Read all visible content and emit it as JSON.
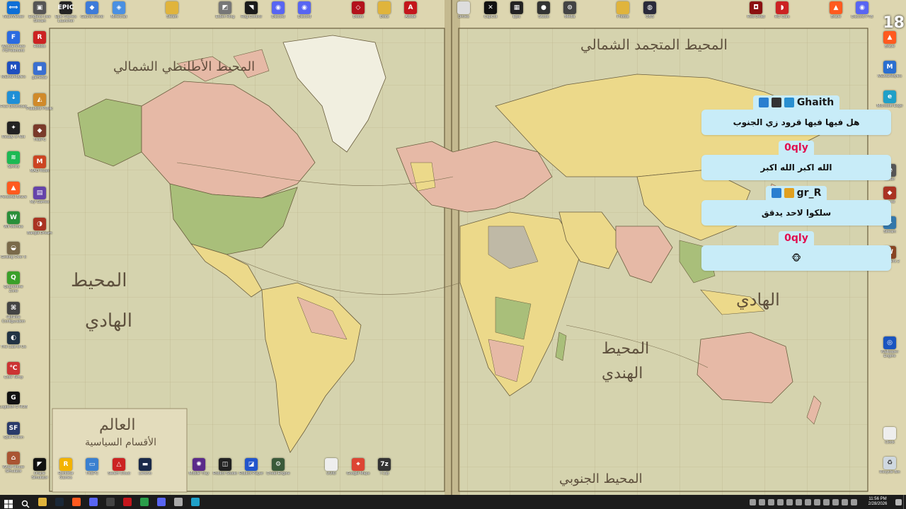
{
  "desktop": {
    "corner_number": "18",
    "top_row": [
      {
        "label": "TeamViewer",
        "icon": "teamviewer-icon",
        "color": "#0e6fd6",
        "glyph": "⟺"
      },
      {
        "label": "Endless Live Stream",
        "icon": "app-icon",
        "color": "#555555",
        "glyph": "▣"
      },
      {
        "label": "Epic Games Launcher",
        "icon": "epic-icon",
        "color": "#222222",
        "glyph": "EPIC"
      },
      {
        "label": "Gacha World",
        "icon": "game-icon",
        "color": "#3d7bd9",
        "glyph": "◆"
      },
      {
        "label": "Minecraft",
        "icon": "minecraft-icon",
        "color": "#4a90e2",
        "glyph": "◈"
      },
      {
        "label": "Steam",
        "icon": "folder-icon",
        "color": "#e0b43c",
        "glyph": ""
      },
      {
        "label": "Elden Ring",
        "icon": "game-icon",
        "color": "#777777",
        "glyph": "◩"
      },
      {
        "label": "Rog Control",
        "icon": "rog-icon",
        "color": "#1a1a1a",
        "glyph": "◥"
      },
      {
        "label": "Discord",
        "icon": "discord-icon",
        "color": "#5865f2",
        "glyph": "◉"
      },
      {
        "label": "Discord",
        "icon": "discord-icon",
        "color": "#5865f2",
        "glyph": "◉"
      },
      {
        "label": "Doom",
        "icon": "game-icon",
        "color": "#b3121b",
        "glyph": "◇"
      },
      {
        "label": "Docs",
        "icon": "folder-icon",
        "color": "#e0b43c",
        "glyph": ""
      },
      {
        "label": "Adobe",
        "icon": "acrobat-icon",
        "color": "#c4161c",
        "glyph": "A"
      },
      {
        "label": "Drives",
        "icon": "drive-icon",
        "color": "#dddddd",
        "glyph": ""
      },
      {
        "label": "CapCut",
        "icon": "capcut-icon",
        "color": "#111111",
        "glyph": "✕"
      },
      {
        "label": "Epic",
        "icon": "app-icon",
        "color": "#222222",
        "glyph": "▦"
      },
      {
        "label": "Studio",
        "icon": "studio-icon",
        "color": "#333333",
        "glyph": "●"
      },
      {
        "label": "Media",
        "icon": "app-icon",
        "color": "#444444",
        "glyph": "⊙"
      },
      {
        "label": "Photos",
        "icon": "folder-icon",
        "color": "#e0b43c",
        "glyph": ""
      },
      {
        "label": "OBS",
        "icon": "obs-icon",
        "color": "#2a2a3a",
        "glyph": "◍"
      },
      {
        "label": "Red Dead",
        "icon": "game-icon",
        "color": "#8b1010",
        "glyph": "◘"
      },
      {
        "label": "RC Cars",
        "icon": "game-icon",
        "color": "#cc2222",
        "glyph": "◗"
      },
      {
        "label": "Brave",
        "icon": "brave-icon",
        "color": "#ff5a1f",
        "glyph": "▲"
      },
      {
        "label": "Discord PTB",
        "icon": "discord-icon",
        "color": "#5865f2",
        "glyph": "◉"
      }
    ],
    "left_col_a": [
      {
        "label": "Wondershare PDFelement",
        "icon": "pdf-icon",
        "color": "#2b6be0",
        "glyph": "F"
      },
      {
        "label": "Malwarebytes",
        "icon": "malwarebytes-icon",
        "color": "#1e4fbf",
        "glyph": "M"
      },
      {
        "label": "Free Download",
        "icon": "download-icon",
        "color": "#1f8fd6",
        "glyph": "↓"
      },
      {
        "label": "Ready or Not",
        "icon": "game-icon",
        "color": "#222222",
        "glyph": "✦"
      },
      {
        "label": "Spotify",
        "icon": "spotify-icon",
        "color": "#1db954",
        "glyph": "≋"
      },
      {
        "label": "Personal Brave",
        "icon": "brave-icon",
        "color": "#ff5a1f",
        "glyph": "▲"
      },
      {
        "label": "Wii Memes",
        "icon": "game-icon",
        "color": "#2a8f3a",
        "glyph": "W"
      },
      {
        "label": "Getting Over It",
        "icon": "game-icon",
        "color": "#7a6a4a",
        "glyph": "◒"
      },
      {
        "label": "Quarantine Zone",
        "icon": "game-icon",
        "color": "#3aa02a",
        "glyph": "Q"
      },
      {
        "label": "HidHide Configuration",
        "icon": "app-icon",
        "color": "#444444",
        "glyph": "⌘"
      },
      {
        "label": "The Last of Us",
        "icon": "game-icon",
        "color": "#223344",
        "glyph": "◐"
      },
      {
        "label": "Core Temp",
        "icon": "app-icon",
        "color": "#cc3333",
        "glyph": "℃"
      },
      {
        "label": "Logitech G HUB",
        "icon": "logitech-icon",
        "color": "#111111",
        "glyph": "G"
      },
      {
        "label": "Split Fiction",
        "icon": "game-icon",
        "color": "#2a3a6a",
        "glyph": "SF"
      },
      {
        "label": "Wrap House Simulator",
        "icon": "game-icon",
        "color": "#aa5533",
        "glyph": "⌂"
      }
    ],
    "left_col_b": [
      {
        "label": "Roblox",
        "icon": "roblox-icon",
        "color": "#cc2222",
        "glyph": "R"
      },
      {
        "label": "gamebar",
        "icon": "app-icon",
        "color": "#3a6fd0",
        "glyph": "◼"
      },
      {
        "label": "Paladins Public",
        "icon": "game-icon",
        "color": "#d08a2a",
        "glyph": "◭"
      },
      {
        "label": "ThisPC",
        "icon": "game-icon",
        "color": "#7a3a2a",
        "glyph": "◆"
      },
      {
        "label": "MAD Rush",
        "icon": "game-icon",
        "color": "#cc4422",
        "glyph": "M"
      },
      {
        "label": "My Games",
        "icon": "app-icon",
        "color": "#6644aa",
        "glyph": "▤"
      },
      {
        "label": "Bangla Dream",
        "icon": "game-icon",
        "color": "#aa3322",
        "glyph": "◑"
      }
    ],
    "bottom_row": [
      {
        "label": "Oracle Simulator",
        "icon": "app-icon",
        "color": "#111111",
        "glyph": "◤"
      },
      {
        "label": "Rockstar Games",
        "icon": "rockstar-icon",
        "color": "#f3b300",
        "glyph": "R"
      },
      {
        "label": "ThisPC",
        "icon": "pc-icon",
        "color": "#3a80d0",
        "glyph": "▭"
      },
      {
        "label": "Steam Cloud",
        "icon": "app-icon",
        "color": "#cc2222",
        "glyph": "△"
      },
      {
        "label": "Lenovo",
        "icon": "app-icon",
        "color": "#1a2a4a",
        "glyph": "▬"
      },
      {
        "label": "Mobile Tray",
        "icon": "app-icon",
        "color": "#5a2a8a",
        "glyph": "✺"
      },
      {
        "label": "Roblox Studio",
        "icon": "roblox-icon",
        "color": "#222222",
        "glyph": "◫"
      },
      {
        "label": "Roblox Player",
        "icon": "roblox-icon",
        "color": "#2255cc",
        "glyph": "◪"
      },
      {
        "label": "Cheat Engine",
        "icon": "app-icon",
        "color": "#3a5a3a",
        "glyph": "⚙"
      },
      {
        "label": "UUID",
        "icon": "file-icon",
        "color": "#eeeeee",
        "glyph": ""
      },
      {
        "label": "Google Maps",
        "icon": "maps-icon",
        "color": "#dd4433",
        "glyph": "⌖"
      },
      {
        "label": "7-Zip",
        "icon": "zip-icon",
        "color": "#333333",
        "glyph": "7z"
      }
    ],
    "right_col": [
      {
        "label": "Brave",
        "icon": "brave-icon",
        "color": "#ff5a1f",
        "glyph": "▲"
      },
      {
        "label": "Malwarebytes",
        "icon": "app-icon",
        "color": "#2a6fd0",
        "glyph": "M"
      },
      {
        "label": "Microsoft Edge",
        "icon": "edge-icon",
        "color": "#1fa0c8",
        "glyph": "e"
      },
      {
        "label": "Roller",
        "icon": "app-icon",
        "color": "#555555",
        "glyph": "◓"
      },
      {
        "label": "Game",
        "icon": "game-icon",
        "color": "#aa3322",
        "glyph": "◆"
      },
      {
        "label": "Stream",
        "icon": "app-icon",
        "color": "#3377aa",
        "glyph": "▶"
      },
      {
        "label": "Wrestlers 2",
        "icon": "game-icon",
        "color": "#884422",
        "glyph": "W"
      },
      {
        "label": "Wallpaper Engine",
        "icon": "wallpaper-icon",
        "color": "#1a55c0",
        "glyph": "◎"
      },
      {
        "label": "Clock",
        "icon": "file-icon",
        "color": "#eeeeee",
        "glyph": ""
      },
      {
        "label": "Recycle Bin",
        "icon": "recycle-bin-icon",
        "color": "#cfd8e0",
        "glyph": "♻"
      }
    ]
  },
  "map": {
    "labels": {
      "atlantic_north": "المحيط الأطلنطي الشمالي",
      "pacific_north": "المحيط المتجمد الشمالي",
      "pacific_left": "المحيط",
      "pacific_left2": "الهادي",
      "indian": "المحيط",
      "indian2": "الهندي",
      "pacific_right": "الهادي",
      "south": "المحيط الجنوبي",
      "legend_title": "العالم",
      "legend_sub": "الأقسام السياسية"
    }
  },
  "chat": {
    "messages": [
      {
        "user": "Ghaith",
        "user_color": "#1a1a1a",
        "badges": [
          "#2a7fd0",
          "#333333",
          "#2a8fd0"
        ],
        "text": "هل فيها فيها قرود زي الجنوب"
      },
      {
        "user": "0qly",
        "user_color": "#e01050",
        "badges": [],
        "text": "الله اكبر الله اكبر"
      },
      {
        "user": "gr_R",
        "user_color": "#1a1a1a",
        "badges": [
          "#2a7fd0",
          "#e0a020"
        ],
        "text": "سلكوا لاحد يدقق"
      },
      {
        "user": "0qly",
        "user_color": "#e01050",
        "badges": [],
        "text": "🐵"
      }
    ]
  },
  "taskbar": {
    "apps": [
      {
        "name": "start-button",
        "color": "#ffffff"
      },
      {
        "name": "search-button",
        "color": "#ffffff"
      },
      {
        "name": "file-explorer",
        "color": "#e0b43c"
      },
      {
        "name": "steam",
        "color": "#1b2838"
      },
      {
        "name": "brave",
        "color": "#ff5a1f"
      },
      {
        "name": "discord",
        "color": "#5865f2"
      },
      {
        "name": "obs",
        "color": "#444444"
      },
      {
        "name": "acrobat",
        "color": "#c4161c"
      },
      {
        "name": "chrome",
        "color": "#2a9d4a"
      },
      {
        "name": "discord-ptb",
        "color": "#5865f2"
      },
      {
        "name": "settings",
        "color": "#aaaaaa"
      },
      {
        "name": "edge",
        "color": "#1fa0c8"
      }
    ],
    "time": "11:56 PM",
    "date": "2/28/2026"
  }
}
